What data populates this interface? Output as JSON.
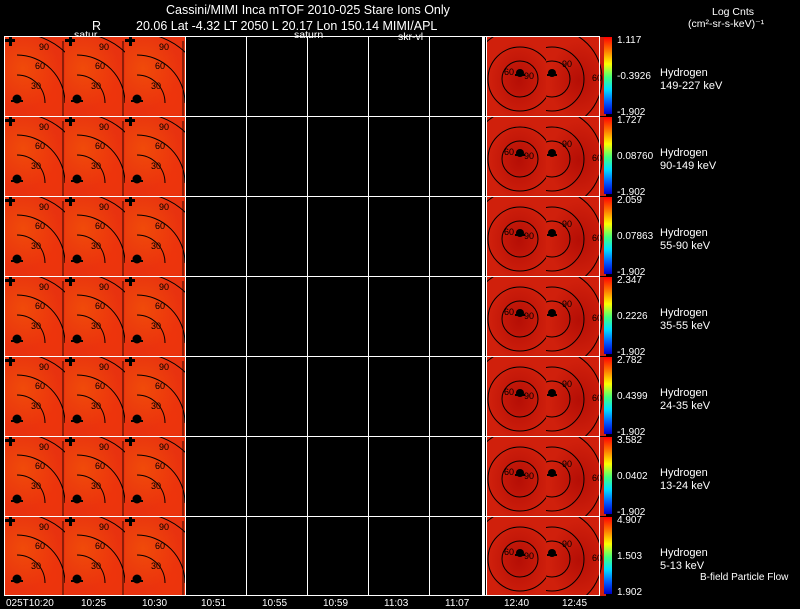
{
  "header": {
    "title": "Cassini/MIMI Inca mTOF  2010-025   Stare    Ions Only",
    "ephem_label_r": "R",
    "ephem_values": "20.06 Lat -4.32 LT 2050 L        20.17 Lon        150.14  MIMI/APL",
    "saturn_label_left": "satur",
    "saturn_label_mid": "saturn",
    "skr_label": "skr-vl"
  },
  "units": {
    "line1": "Log Cnts",
    "line2": "(cm²-sr-s-keV)⁻¹"
  },
  "contour_labels": [
    "90",
    "60",
    "30"
  ],
  "right_contour_labels": [
    "60",
    "90",
    "60"
  ],
  "rows": [
    {
      "species": "Hydrogen",
      "energy": "149-227 keV",
      "cmax": "1.117",
      "cmid": "-0.3926",
      "cmin": "-1.902"
    },
    {
      "species": "Hydrogen",
      "energy": "90-149 keV",
      "cmax": "1.727",
      "cmid": "0.08760",
      "cmin": "-1.902"
    },
    {
      "species": "Hydrogen",
      "energy": "55-90 keV",
      "cmax": "2.059",
      "cmid": "0.07863",
      "cmin": "-1.902"
    },
    {
      "species": "Hydrogen",
      "energy": "35-55 keV",
      "cmax": "2.347",
      "cmid": "0.2226",
      "cmin": "-1.902"
    },
    {
      "species": "Hydrogen",
      "energy": "24-35 keV",
      "cmax": "2.782",
      "cmid": "0.4399",
      "cmin": "-1.902"
    },
    {
      "species": "Hydrogen",
      "energy": "13-24 keV",
      "cmax": "3.582",
      "cmid": "0.0402",
      "cmin": "-1.902"
    },
    {
      "species": "Hydrogen",
      "energy": "5-13 keV",
      "cmax": "4.907",
      "cmid": "1.503",
      "cmin": "1.902"
    }
  ],
  "footer_note": "B-field Particle Flow",
  "time_ticks": [
    "025T10:20",
    "10:25",
    "10:30",
    "10:51",
    "10:55",
    "10:59",
    "11:03",
    "11:07",
    "12:40",
    "12:45"
  ],
  "colors": {
    "background": "#000000",
    "panel_orange": "#e8320f",
    "panel_red": "#d0200c",
    "grid": "#ffffff"
  }
}
